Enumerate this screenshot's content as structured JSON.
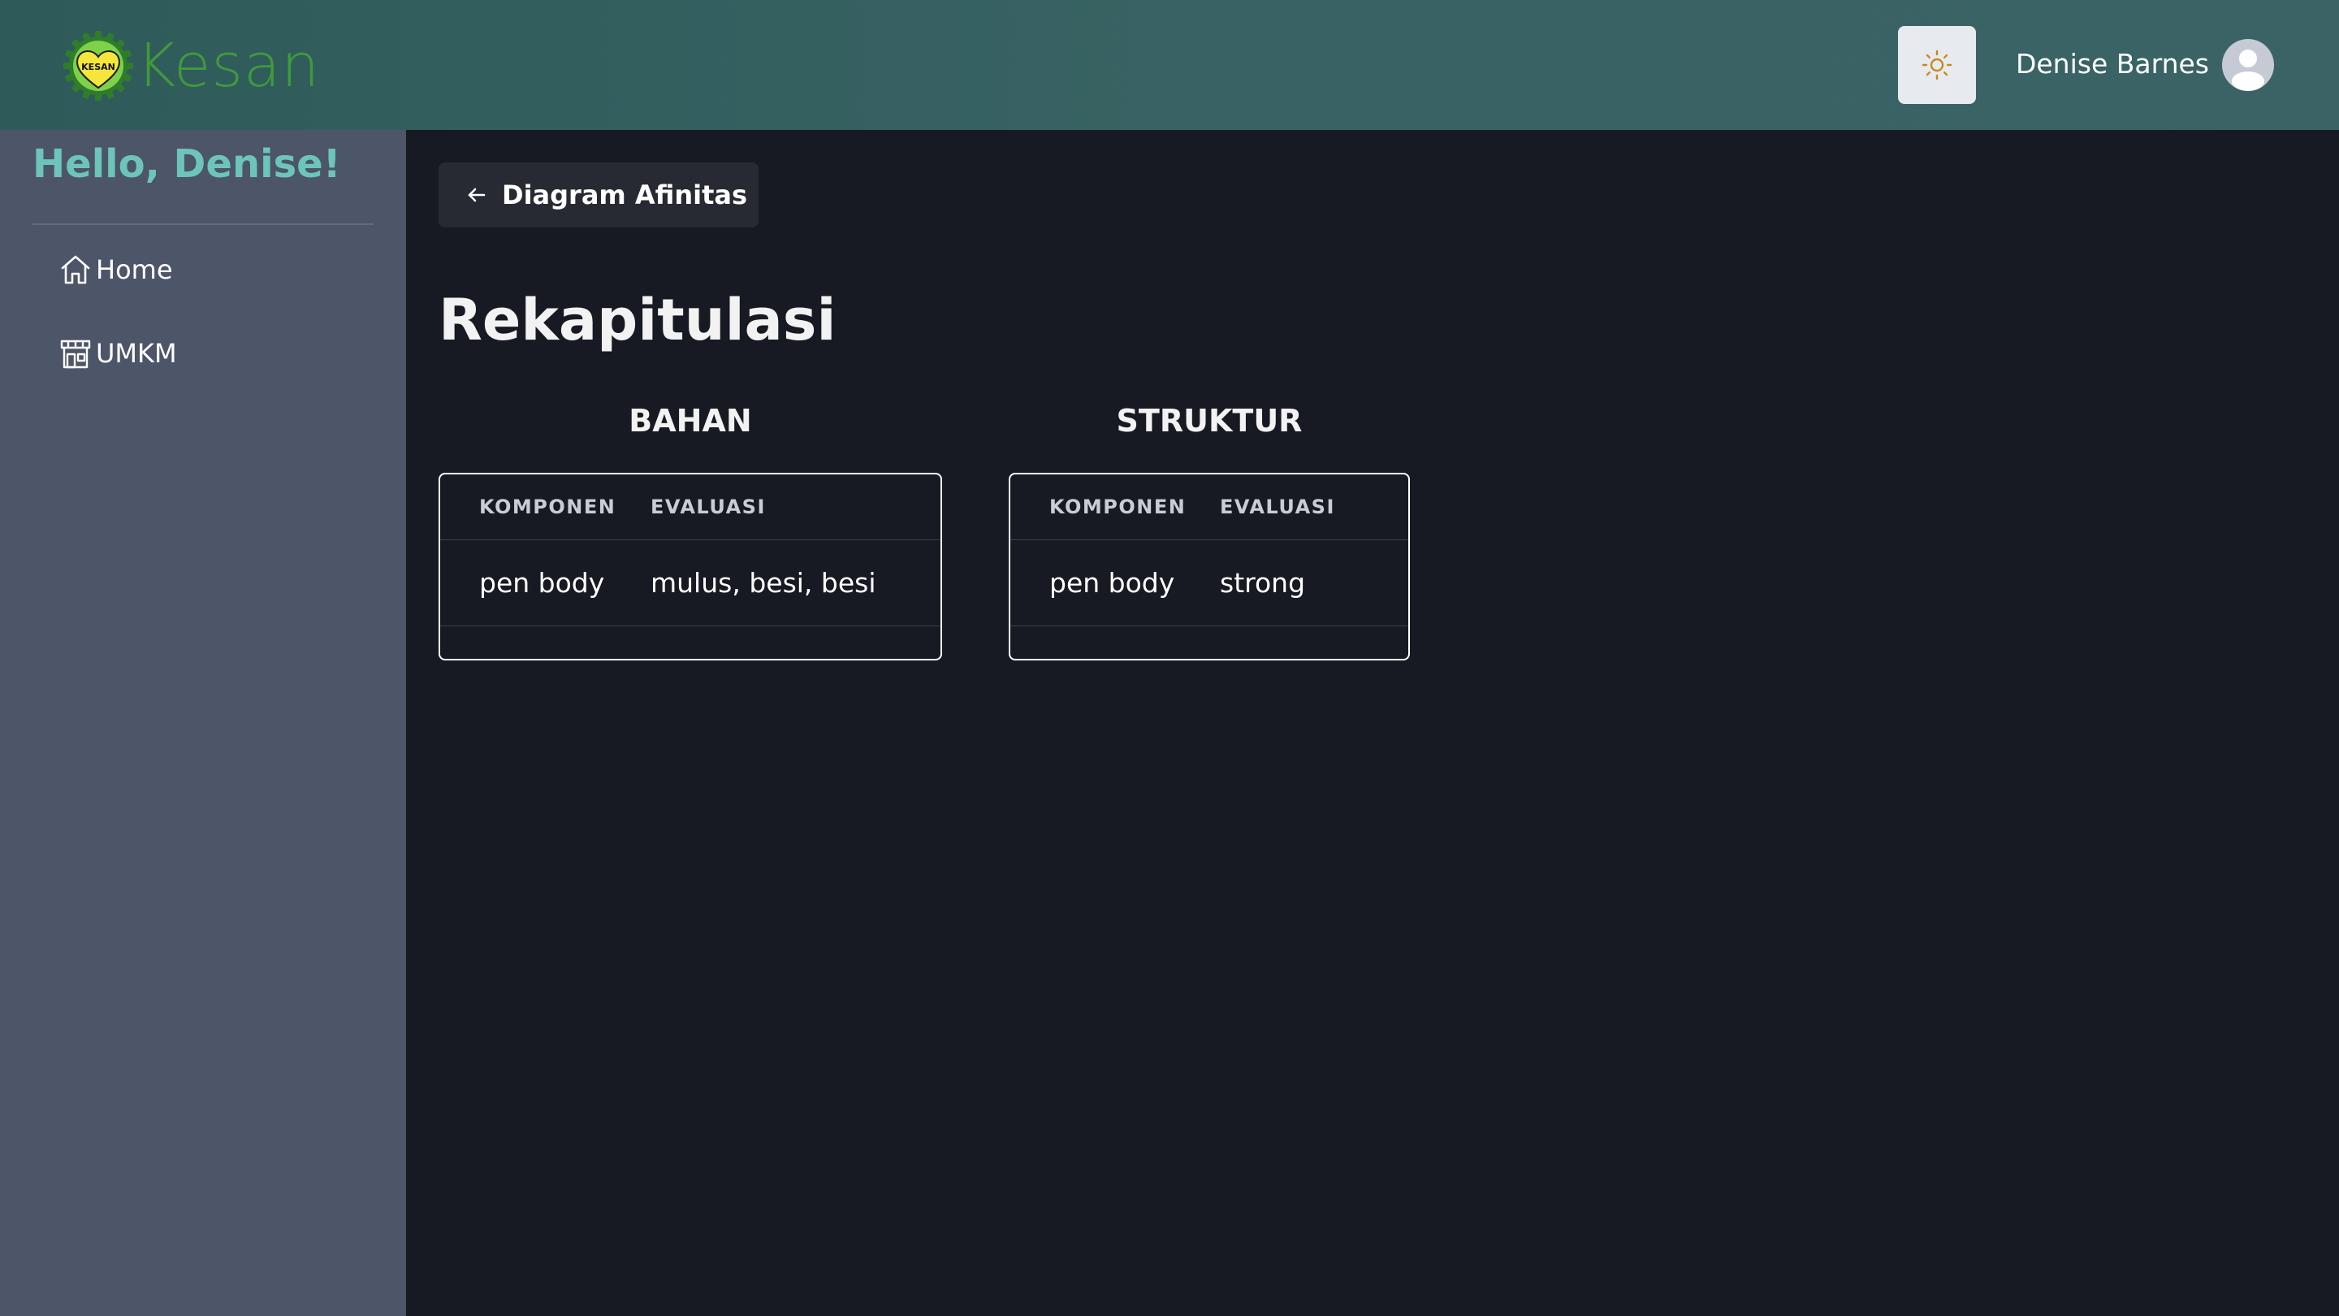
{
  "header": {
    "brand": "Kesan",
    "brand_badge_text": "KESAN",
    "user_name": "Denise Barnes",
    "theme_toggle_icon": "sun-icon",
    "avatar_icon": "user-avatar-icon"
  },
  "sidebar": {
    "greeting": "Hello, Denise!",
    "items": [
      {
        "label": "Home",
        "icon": "home-icon"
      },
      {
        "label": "UMKM",
        "icon": "store-icon"
      }
    ]
  },
  "main": {
    "back_button": {
      "label": "Diagram Afinitas",
      "icon": "arrow-left-icon"
    },
    "title": "Rekapitulasi",
    "sections": [
      {
        "title": "BAHAN",
        "columns": [
          "KOMPONEN",
          "EVALUASI"
        ],
        "rows": [
          [
            "pen body",
            "mulus, besi, besi"
          ]
        ]
      },
      {
        "title": "STRUKTUR",
        "columns": [
          "KOMPONEN",
          "EVALUASI"
        ],
        "rows": [
          [
            "pen body",
            "strong"
          ]
        ]
      }
    ]
  },
  "colors": {
    "header_bg": "#386263",
    "sidebar_bg": "#4d5568",
    "main_bg": "#171a22",
    "greeting": "#6cc5b8",
    "brand": "#3f9a3c",
    "sun_icon": "#c98a1a"
  }
}
